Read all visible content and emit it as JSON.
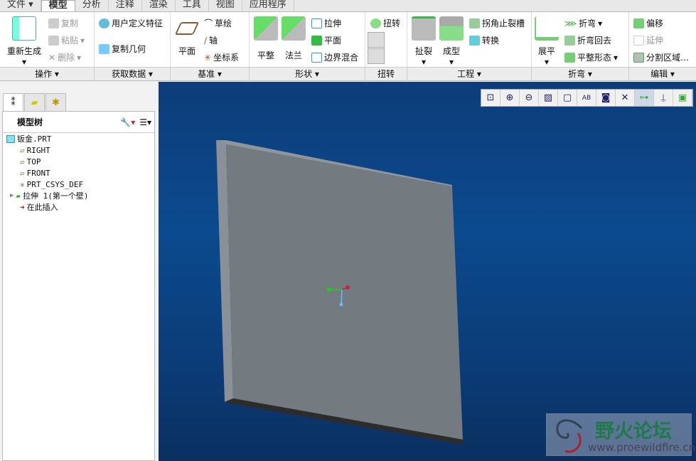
{
  "menu": {
    "tabs": [
      "文件 ▾",
      "模型",
      "分析",
      "注释",
      "渲染",
      "工具",
      "视图",
      "应用程序"
    ],
    "active": 1
  },
  "ribbon": {
    "ops": {
      "regen": "重新生成",
      "copy": "复制",
      "paste": "粘贴",
      "delete": "删除",
      "group": "操作"
    },
    "getdata": {
      "udf": "用户定义特征",
      "copygeom": "复制几何",
      "group": "获取数据"
    },
    "datum": {
      "plane": "平面",
      "sketch": "草绘",
      "axis": "轴",
      "csys": "坐标系",
      "group": "基准"
    },
    "shapes": {
      "flat": "平整",
      "flange": "法兰",
      "extrude": "拉伸",
      "plane": "平面",
      "blend": "边界混合",
      "group": "形状"
    },
    "twist": {
      "twist": "扭转",
      "group": "扭转"
    },
    "eng": {
      "rip": "扯裂",
      "form": "成型",
      "corner": "拐角止裂槽",
      "convert": "转换",
      "group": "工程"
    },
    "bend": {
      "unbend": "展平",
      "bend": "折弯",
      "bendback": "折弯回去",
      "flatstate": "平整形态",
      "group": "折弯"
    },
    "edit": {
      "offset": "偏移",
      "extend": "延伸",
      "split": "分割区域…",
      "group": "编辑"
    }
  },
  "tree": {
    "title": "模型树",
    "items": [
      {
        "label": "钣金.PRT",
        "icon": "part-icon",
        "indent": 0
      },
      {
        "label": "RIGHT",
        "icon": "datum-plane-icon",
        "indent": 1
      },
      {
        "label": "TOP",
        "icon": "datum-plane-icon",
        "indent": 1
      },
      {
        "label": "FRONT",
        "icon": "datum-plane-icon",
        "indent": 1
      },
      {
        "label": "PRT_CSYS_DEF",
        "icon": "csys-icon",
        "indent": 1
      },
      {
        "label": "拉伸 1(第一个壁)",
        "icon": "extrude-icon",
        "indent": 1,
        "expandable": true
      },
      {
        "label": "在此插入",
        "icon": "insert-arrow-icon",
        "indent": 1
      }
    ]
  },
  "viewtools": [
    "zoom-fit-icon",
    "zoom-in-icon",
    "zoom-out-icon",
    "repaint-icon",
    "display-style-icon",
    "saved-views-icon",
    "view-manager-icon",
    "datum-display-icon",
    "spin-center-icon",
    "annotation-display-icon",
    "appearance-icon"
  ],
  "watermark": {
    "name": "野火论坛",
    "url": "www.proewildfire.cn"
  },
  "colors": {
    "viewport": "#0b4a8e",
    "plate": "#737a80",
    "accent": "#2fa84f"
  }
}
